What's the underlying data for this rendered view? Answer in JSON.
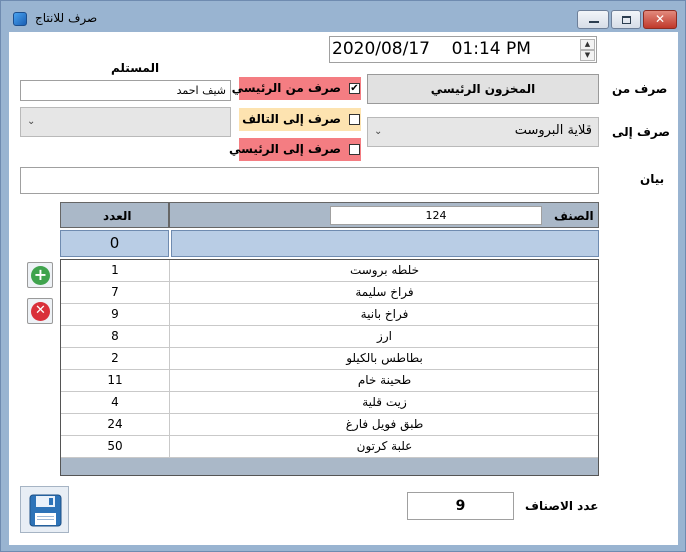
{
  "window": {
    "title": "صرف للانتاج"
  },
  "datetime": {
    "value": "2020/08/17    01:14 PM"
  },
  "receiver": {
    "label": "المستلم",
    "value": "شيف احمد",
    "combo_value": ""
  },
  "from": {
    "label": "صرف من",
    "value": "المخزون الرئيسي"
  },
  "to": {
    "label": "صرف إلى",
    "value": "قلاية البروست"
  },
  "options": [
    {
      "label": "صرف من الرئيسي",
      "checked": true,
      "bg": "#f47d82"
    },
    {
      "label": "صرف إلى التالف",
      "checked": false,
      "bg": "#fde3b0"
    },
    {
      "label": "صرف إلى الرئيسي",
      "checked": false,
      "bg": "#f47d82"
    }
  ],
  "statement": {
    "label": "بيان",
    "value": ""
  },
  "grid": {
    "count_header": "العدد",
    "item_header": "الصنف",
    "item_input": "124",
    "entry_count": "0",
    "rows": [
      {
        "count": "1",
        "name": "خلطه بروست"
      },
      {
        "count": "7",
        "name": "فراخ سليمة"
      },
      {
        "count": "9",
        "name": "فراخ بانية"
      },
      {
        "count": "8",
        "name": "ارز"
      },
      {
        "count": "2",
        "name": "بطاطس بالكيلو"
      },
      {
        "count": "11",
        "name": "طحينة خام"
      },
      {
        "count": "4",
        "name": "زيت قلية"
      },
      {
        "count": "24",
        "name": "طبق فويل فارغ"
      },
      {
        "count": "50",
        "name": "علبة كرتون"
      }
    ]
  },
  "summary": {
    "label": "عدد الاصناف",
    "value": "9"
  },
  "icons": {
    "app": "app-icon",
    "add": "plus-icon",
    "delete": "close-circle-icon",
    "save": "floppy-disk-icon"
  },
  "colors": {
    "title_bar": "#99b4d1",
    "grid_header": "#aab8c8",
    "add_green": "#3fa34d",
    "delete_red": "#d9303a"
  }
}
